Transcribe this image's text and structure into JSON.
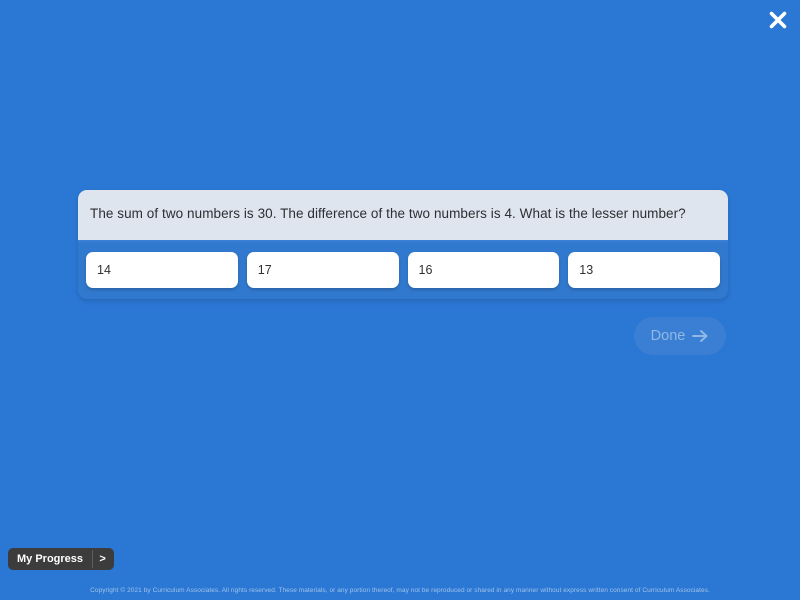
{
  "background_color": "#2b77d4",
  "close": {
    "icon": "close-icon"
  },
  "question": {
    "text": "The sum of two numbers is 30. The difference of the two numbers is 4. What is the lesser number?",
    "panel_color": "#dfe5ee"
  },
  "options": [
    {
      "label": "14"
    },
    {
      "label": "17"
    },
    {
      "label": "16"
    },
    {
      "label": "13"
    }
  ],
  "done": {
    "label": "Done",
    "icon": "arrow-right-icon",
    "state": "disabled",
    "fill_color": "#3b7fd4",
    "text_color": "#8fb8e4"
  },
  "progress": {
    "label": "My Progress",
    "expand_label": ">"
  },
  "footer": {
    "copyright": "Copyright © 2021 by Curriculum Associates. All rights reserved. These materials, or any portion thereof, may not be reproduced or shared in any manner without express written consent of Curriculum Associates."
  }
}
